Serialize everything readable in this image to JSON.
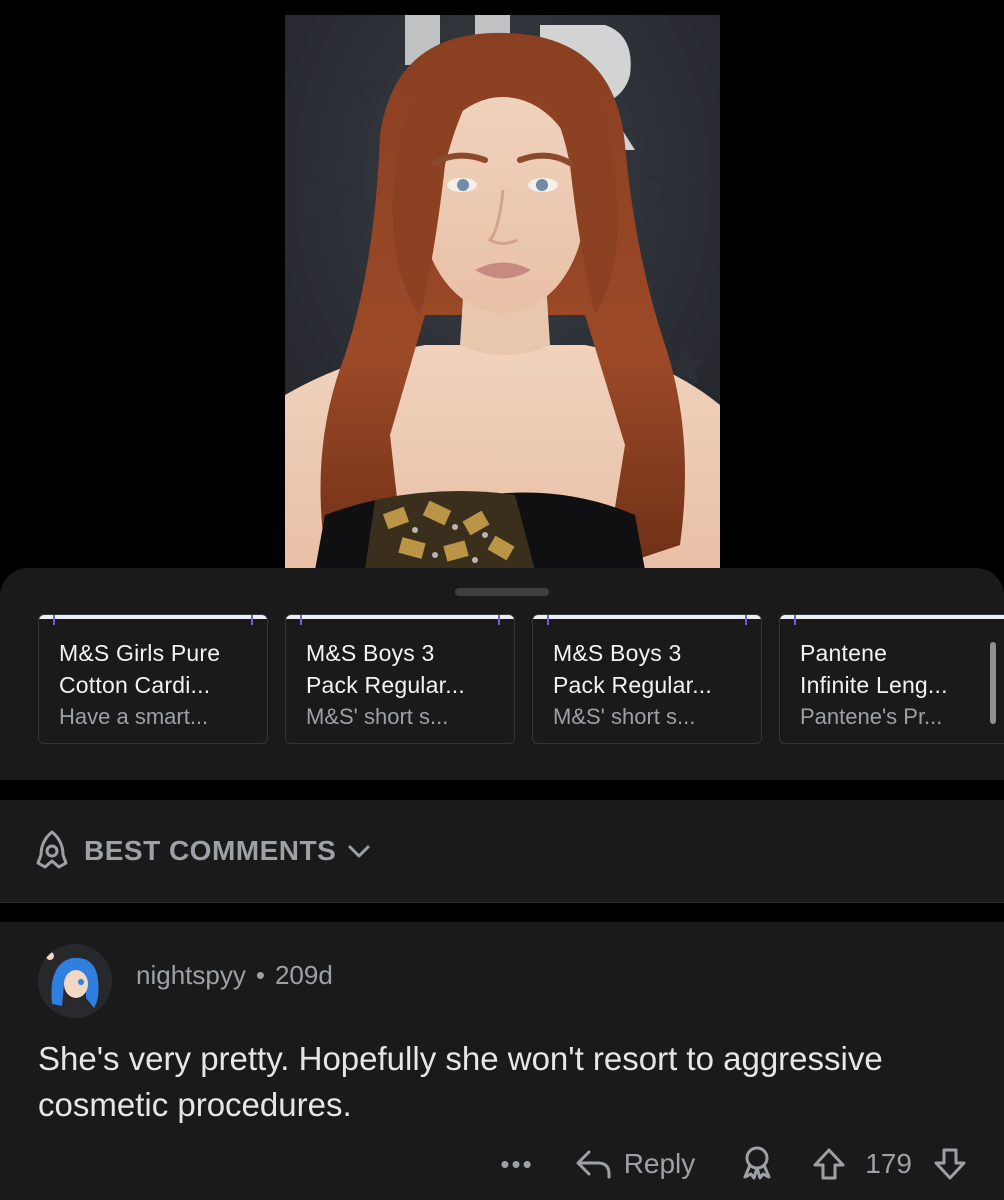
{
  "products": [
    {
      "title": "M&S Girls Pure\nCotton Cardi...",
      "subtitle": "Have a smart..."
    },
    {
      "title": "M&S Boys 3\nPack Regular...",
      "subtitle": "M&S' short s..."
    },
    {
      "title": "M&S Boys 3\nPack Regular...",
      "subtitle": "M&S' short s..."
    },
    {
      "title": "Pantene\nInfinite Leng...",
      "subtitle": "Pantene's Pr..."
    }
  ],
  "sort": {
    "label": "BEST COMMENTS",
    "icon": "rocket-icon"
  },
  "comment": {
    "username": "nightspyy",
    "separator": "•",
    "age": "209d",
    "body": "She's very pretty. Hopefully she won't resort to aggressive cosmetic procedures.",
    "more": "•••",
    "reply_label": "Reply",
    "score": "179"
  },
  "colors": {
    "background": "#000000",
    "surface": "#1a1a1b",
    "muted_text": "#9da1a6",
    "primary_text": "#e4e6e8"
  }
}
